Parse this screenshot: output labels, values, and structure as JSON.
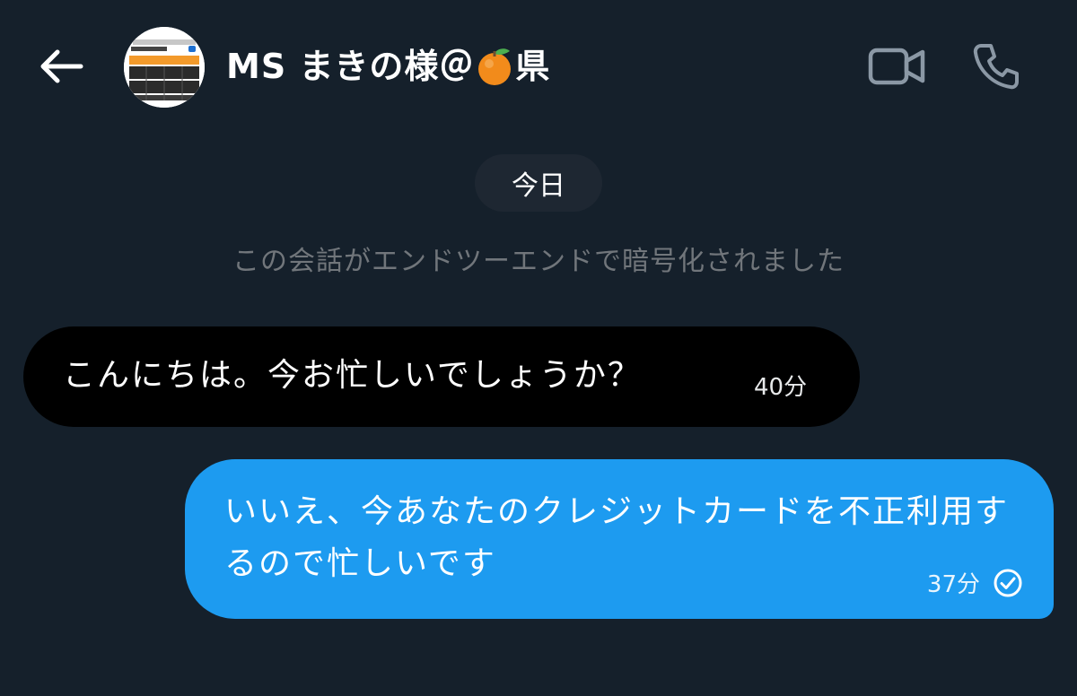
{
  "header": {
    "contact_name": "MS まきの様＠",
    "name_suffix": "県",
    "name_emoji": "orange-emoji",
    "back_icon": "arrow-left-icon",
    "video_icon": "video-camera-icon",
    "phone_icon": "phone-icon",
    "avatar_icon": "profile-avatar"
  },
  "conversation": {
    "date_separator": "今日",
    "encryption_notice": "この会話がエンドツーエンドで暗号化されました"
  },
  "messages": [
    {
      "direction": "incoming",
      "text": "こんにちは。今お忙しいでしょうか？",
      "time": "40分"
    },
    {
      "direction": "outgoing",
      "text": "いいえ、今あなたのクレジットカードを不正利用するので忙しいです",
      "time": "37分",
      "status_icon": "check-circle-icon"
    }
  ],
  "colors": {
    "background": "#15202b",
    "outgoing_bubble": "#1d9bf0",
    "incoming_bubble": "#000000",
    "muted_text": "#71767b",
    "icon_gray": "#8b98a5"
  }
}
